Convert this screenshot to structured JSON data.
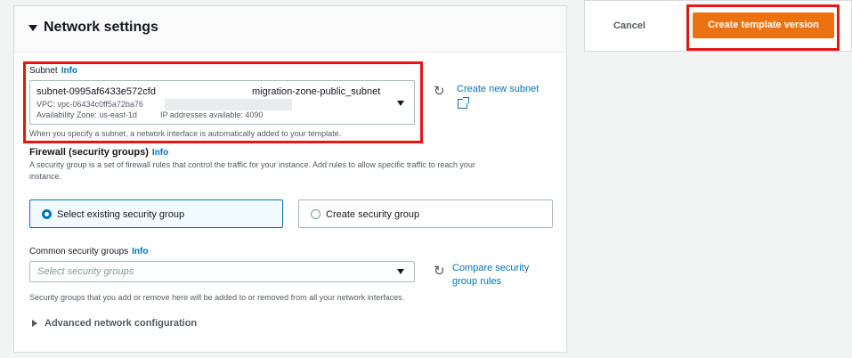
{
  "actions": {
    "cancel_label": "Cancel",
    "create_label": "Create template version"
  },
  "network": {
    "title": "Network settings",
    "subnet": {
      "label": "Subnet",
      "info": "Info",
      "selected_id": "subnet-0995af6433e572cfd",
      "selected_name": "migration-zone-public_subnet",
      "vpc": "VPC: vpc-06434c0ff5a72ba76",
      "az": "Availability Zone: us-east-1d",
      "ips": "IP addresses available: 4090",
      "help": "When you specify a subnet, a network interface is automatically added to your template.",
      "create_link": "Create new subnet"
    },
    "firewall": {
      "label": "Firewall (security groups)",
      "info": "Info",
      "desc_line1": "A security group is a set of firewall rules that control the traffic for your instance. Add rules to allow specific traffic to reach your",
      "desc_line2": "instance.",
      "option_existing": "Select existing security group",
      "option_create": "Create security group",
      "selected": "existing"
    },
    "common_sg": {
      "label": "Common security groups",
      "info": "Info",
      "placeholder": "Select security groups",
      "compare_line1": "Compare security",
      "compare_line2": "group rules",
      "help": "Security groups that you add or remove here will be added to or removed from all your network interfaces."
    },
    "advanced_label": "Advanced network configuration"
  },
  "colors": {
    "primary_button": "#ec7211",
    "link": "#0073bb",
    "highlight_box": "#e8160c"
  },
  "icons": [
    "caret-down-icon",
    "refresh-icon",
    "external-link-icon",
    "caret-right-icon"
  ]
}
